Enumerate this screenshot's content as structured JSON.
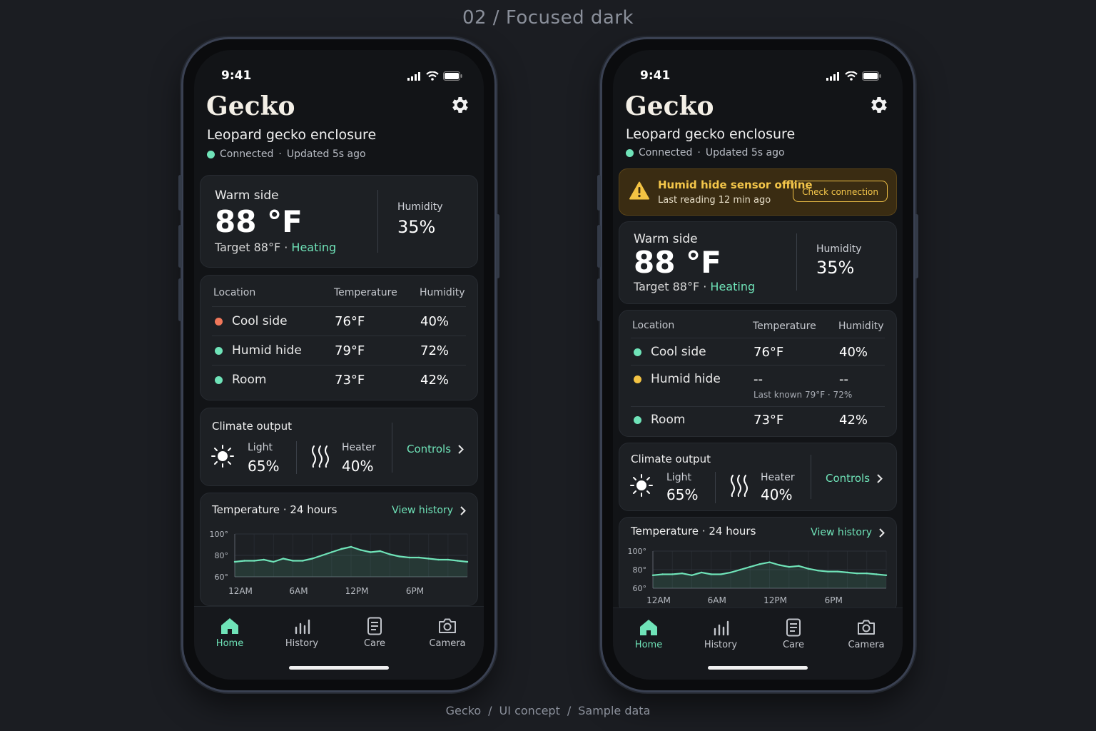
{
  "page": {
    "title": "02 / Focused dark",
    "footer": [
      "Gecko",
      "UI concept",
      "Sample data"
    ]
  },
  "colors": {
    "accent": "#6fe3b8",
    "warning": "#f3c343",
    "alert_dot": "#f0775a",
    "background": "#1b1d22",
    "card": "#1d2024"
  },
  "status_bar": {
    "time": "9:41"
  },
  "app": {
    "title": "Gecko",
    "enclosure": "Leopard gecko enclosure",
    "connection": "Connected",
    "separator": "·",
    "updated": "Updated 5s ago"
  },
  "warm_side": {
    "label": "Warm side",
    "temperature": "88 °F",
    "target": "Target 88°F",
    "status": "Heating",
    "humidity_label": "Humidity",
    "humidity": "35%"
  },
  "alert": {
    "title": "Humid hide sensor offline",
    "subtitle": "Last reading 12 min ago",
    "button": "Check connection"
  },
  "sensors": {
    "headers": {
      "location": "Location",
      "temperature": "Temperature",
      "humidity": "Humidity"
    },
    "rows_normal": [
      {
        "name": "Cool side",
        "status": "alert",
        "temperature": "76°F",
        "humidity": "40%"
      },
      {
        "name": "Humid hide",
        "status": "ok",
        "temperature": "79°F",
        "humidity": "72%"
      },
      {
        "name": "Room",
        "status": "ok",
        "temperature": "73°F",
        "humidity": "42%"
      }
    ],
    "rows_alert": [
      {
        "name": "Cool side",
        "status": "ok",
        "temperature": "76°F",
        "humidity": "40%"
      },
      {
        "name": "Humid hide",
        "status": "warning",
        "temperature": "--",
        "humidity": "--",
        "note": "Last known 79°F · 72%"
      },
      {
        "name": "Room",
        "status": "ok",
        "temperature": "73°F",
        "humidity": "42%"
      }
    ]
  },
  "climate_output": {
    "title": "Climate output",
    "light_label": "Light",
    "light_value": "65%",
    "heater_label": "Heater",
    "heater_value": "40%",
    "controls": "Controls"
  },
  "temp_chart": {
    "title": "Temperature",
    "separator": "·",
    "period": "24 hours",
    "view_history": "View history"
  },
  "chart_data": {
    "type": "area",
    "ylim": [
      60,
      100
    ],
    "yticks": [
      "100°",
      "80°",
      "60°"
    ],
    "xticks": [
      "12AM",
      "6AM",
      "12PM",
      "6PM"
    ],
    "x_hours": [
      0,
      1,
      2,
      3,
      4,
      5,
      6,
      7,
      8,
      9,
      10,
      11,
      12,
      13,
      14,
      15,
      16,
      17,
      18,
      19,
      20,
      21,
      22,
      23,
      24
    ],
    "values": [
      74,
      75,
      75,
      76,
      74,
      77,
      75,
      75,
      77,
      80,
      83,
      86,
      88,
      85,
      83,
      84,
      81,
      79,
      78,
      78,
      77,
      76,
      76,
      75,
      74
    ],
    "grid": true
  },
  "tabs": [
    {
      "label": "Home",
      "icon": "home-icon",
      "active": true
    },
    {
      "label": "History",
      "icon": "bar-chart-icon",
      "active": false
    },
    {
      "label": "Care",
      "icon": "document-icon",
      "active": false
    },
    {
      "label": "Camera",
      "icon": "camera-icon",
      "active": false
    }
  ]
}
